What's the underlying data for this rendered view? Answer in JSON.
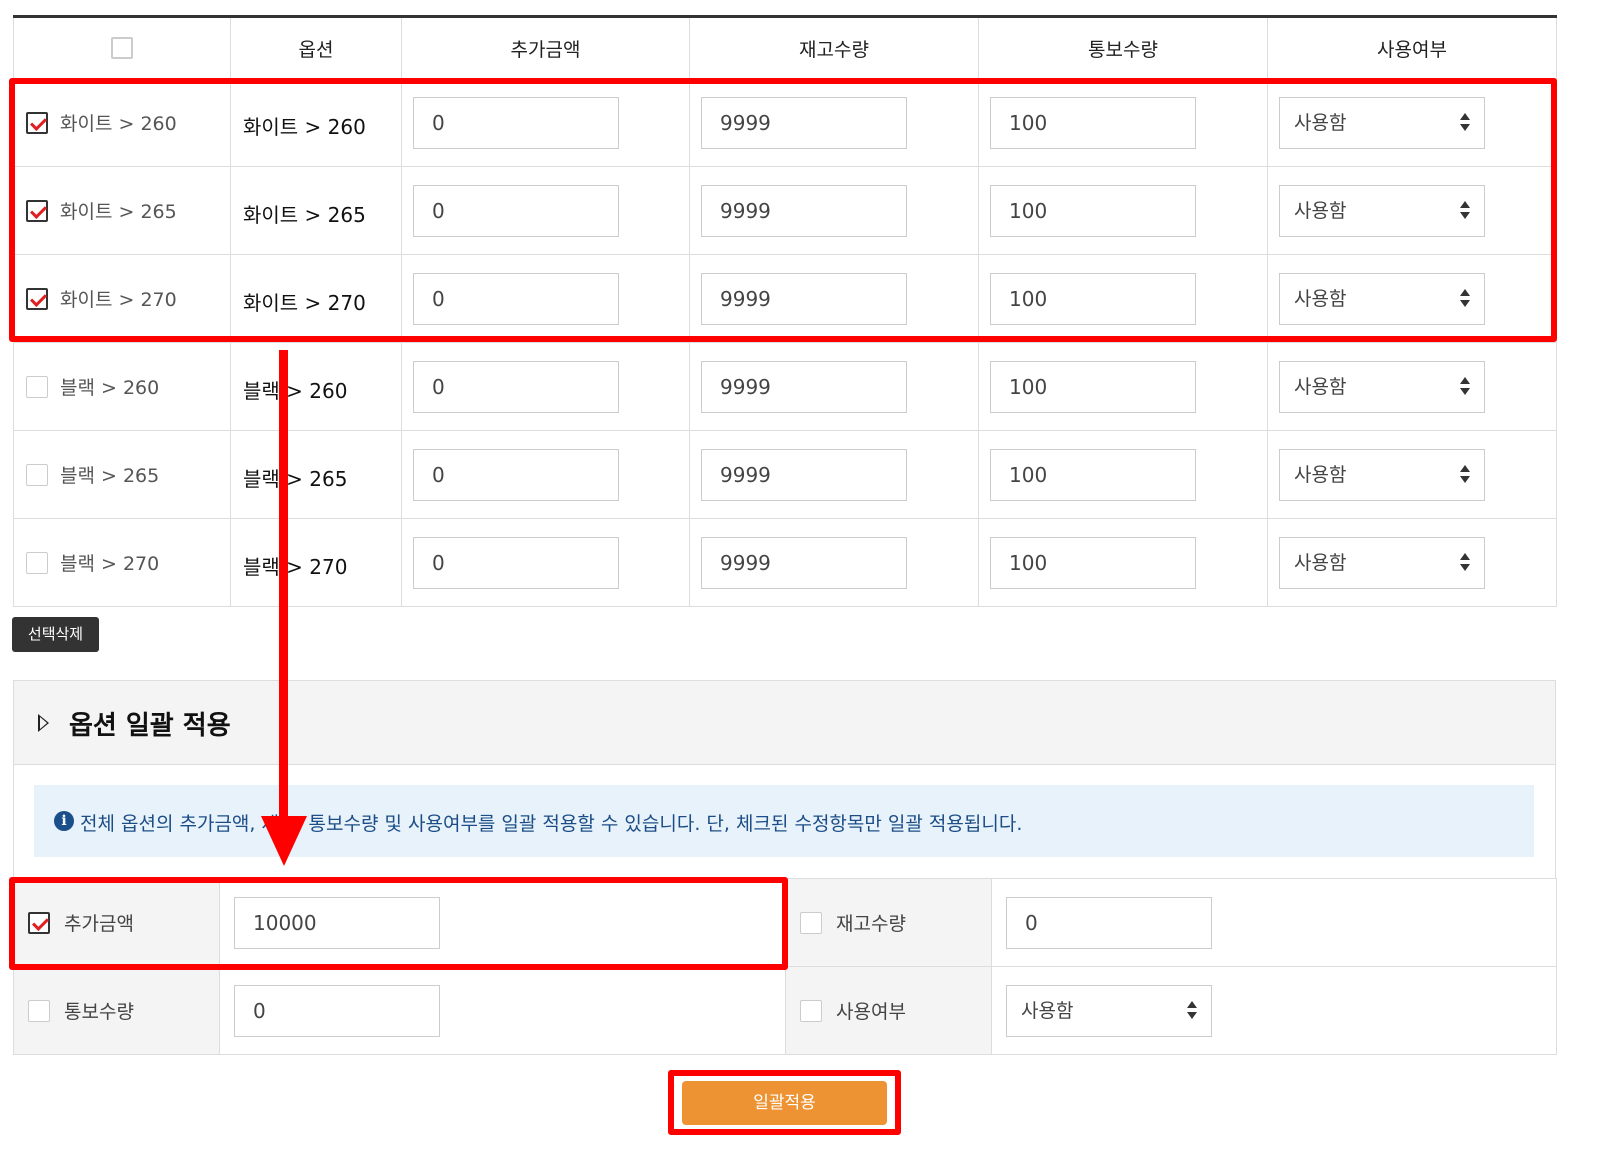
{
  "table": {
    "headers": [
      "옵션",
      "추가금액",
      "재고수량",
      "통보수량",
      "사용여부"
    ],
    "rows": [
      {
        "checked": true,
        "name": "화이트 > 260",
        "option": "화이트 > 260",
        "extra_price": "0",
        "stock": "9999",
        "notify": "100",
        "usage": "사용함"
      },
      {
        "checked": true,
        "name": "화이트 > 265",
        "option": "화이트 > 265",
        "extra_price": "0",
        "stock": "9999",
        "notify": "100",
        "usage": "사용함"
      },
      {
        "checked": true,
        "name": "화이트 > 270",
        "option": "화이트 > 270",
        "extra_price": "0",
        "stock": "9999",
        "notify": "100",
        "usage": "사용함"
      },
      {
        "checked": false,
        "name": "블랙 > 260",
        "option": "블랙 > 260",
        "extra_price": "0",
        "stock": "9999",
        "notify": "100",
        "usage": "사용함"
      },
      {
        "checked": false,
        "name": "블랙 > 265",
        "option": "블랙 > 265",
        "extra_price": "0",
        "stock": "9999",
        "notify": "100",
        "usage": "사용함"
      },
      {
        "checked": false,
        "name": "블랙 > 270",
        "option": "블랙 > 270",
        "extra_price": "0",
        "stock": "9999",
        "notify": "100",
        "usage": "사용함"
      }
    ]
  },
  "delete_button": "선택삭제",
  "bulk": {
    "title": "옵션 일괄 적용",
    "notice": "전체 옵션의 추가금액, 재고, 통보수량 및 사용여부를 일괄 적용할 수 있습니다. 단, 체크된 수정항목만 일괄 적용됩니다.",
    "extra_price": {
      "label": "추가금액",
      "checked": true,
      "value": "10000"
    },
    "stock": {
      "label": "재고수량",
      "checked": false,
      "value": "0"
    },
    "notify": {
      "label": "통보수량",
      "checked": false,
      "value": "0"
    },
    "usage": {
      "label": "사용여부",
      "checked": false,
      "value": "사용함"
    },
    "apply_button": "일괄적용"
  },
  "colors": {
    "annotation": "#ff0000",
    "apply_button": "#ee9334",
    "notice_bg": "#e8f2fb",
    "notice_text": "#1c4d86",
    "dark_button": "#333333"
  }
}
